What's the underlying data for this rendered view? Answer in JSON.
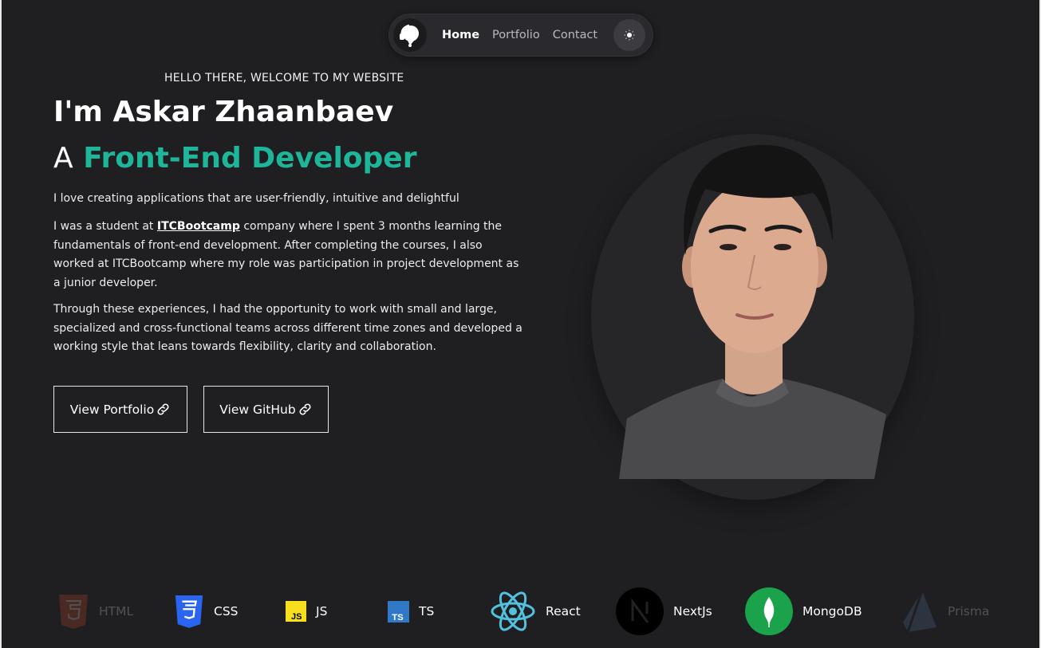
{
  "nav": {
    "logo": "headphones-avatar-logo",
    "links": [
      "Home",
      "Portfolio",
      "Contact"
    ],
    "active": "Home",
    "theme_icon": "sun-icon"
  },
  "hero": {
    "greeting": "HELLO THERE, WELCOME TO MY WEBSITE",
    "name": "I'm Askar Zhaanbaev",
    "role_prefix": "A",
    "role_accent": "Front-End Developer",
    "paragraph1": "I love creating applications that are user-friendly, intuitive and delightful",
    "paragraph2_before": "I was a student at ",
    "paragraph2_link": "ITCBootcamp",
    "paragraph2_after": " company where I spent 3 months learning the fundamentals of front-end development. After completing the courses, I also worked at ITCBootcamp where my role was participation in project development as a junior developer.",
    "paragraph3": "Through these experiences, I had the opportunity to work with small and large, specialized and cross-functional teams across different time zones and developed a working style that leans towards flexibility, clarity and collaboration.",
    "buttons": {
      "portfolio": "View Portfolio",
      "github": "View GitHub"
    }
  },
  "tech": [
    {
      "label": "HTML",
      "icon": "html5-icon"
    },
    {
      "label": "CSS",
      "icon": "css3-icon"
    },
    {
      "label": "JS",
      "icon": "javascript-icon"
    },
    {
      "label": "TS",
      "icon": "typescript-icon"
    },
    {
      "label": "React",
      "icon": "react-icon"
    },
    {
      "label": "NextJs",
      "icon": "nextjs-icon"
    },
    {
      "label": "MongoDB",
      "icon": "mongodb-icon"
    },
    {
      "label": "Prisma",
      "icon": "prisma-icon"
    }
  ],
  "colors": {
    "background": "#1f1f22",
    "accent": "#1fb59a",
    "text": "#ffffff"
  }
}
